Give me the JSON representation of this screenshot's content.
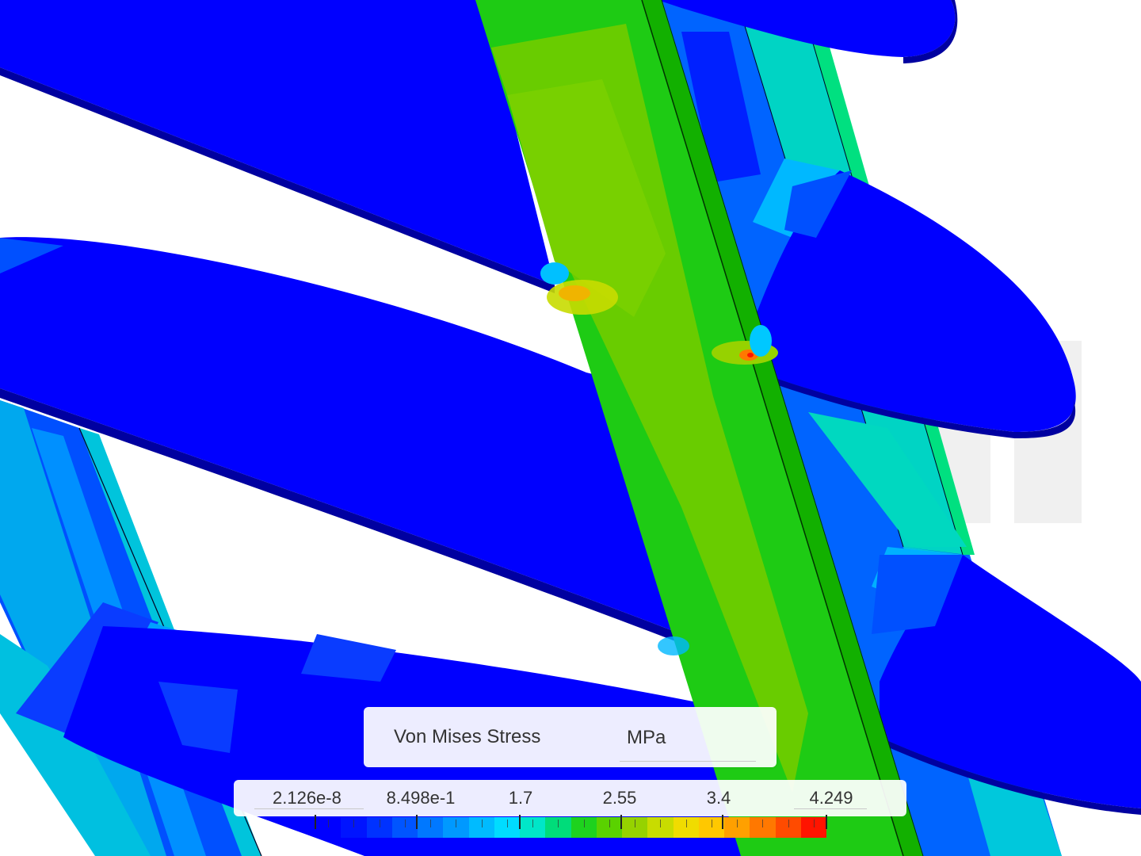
{
  "legend": {
    "title": "Von Mises Stress",
    "unit": "MPa",
    "ticks": [
      "2.126e-8",
      "8.498e-1",
      "1.7",
      "2.55",
      "3.4",
      "4.249"
    ],
    "colors": [
      "#0000ff",
      "#0014ff",
      "#0032ff",
      "#0055ff",
      "#0078ff",
      "#0099ff",
      "#00bbff",
      "#00dcff",
      "#00e6c8",
      "#00dc7a",
      "#1ed21e",
      "#5ad200",
      "#96d200",
      "#c8dc00",
      "#f0dc00",
      "#ffc800",
      "#ffa000",
      "#ff7800",
      "#ff4b00",
      "#ff1400"
    ]
  },
  "scene": {
    "colors": {
      "low": "#0000ff",
      "rim": "#00008c",
      "cyan": "#00c8e0",
      "teal": "#00d2c8",
      "green": "#1ecb14",
      "yellowgreen": "#69cc00",
      "hot": "#ff5a00"
    }
  }
}
